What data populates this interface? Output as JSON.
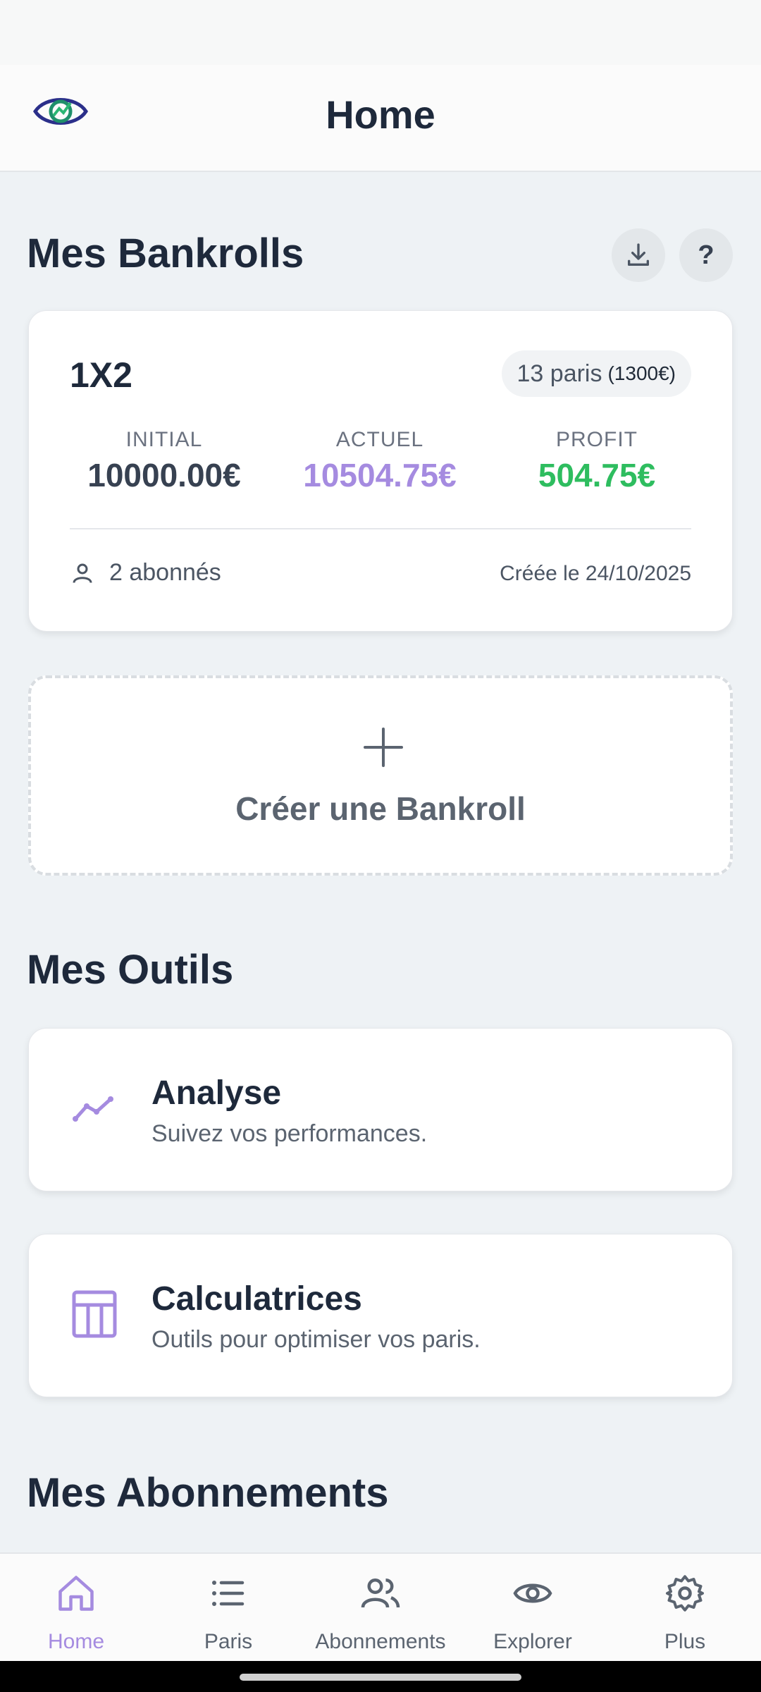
{
  "header": {
    "title": "Home"
  },
  "bankrolls": {
    "section_title": "Mes Bankrolls",
    "items": [
      {
        "name": "1X2",
        "bets_badge": "13 paris",
        "bets_badge_amount": "(1300€)",
        "initial_label": "INITIAL",
        "initial_value": "10000.00€",
        "current_label": "ACTUEL",
        "current_value": "10504.75€",
        "profit_label": "PROFIT",
        "profit_value": "504.75€",
        "followers": "2 abonnés",
        "created": "Créée le 24/10/2025"
      }
    ],
    "create_label": "Créer une Bankroll"
  },
  "tools": {
    "section_title": "Mes Outils",
    "items": [
      {
        "title": "Analyse",
        "subtitle": "Suivez vos performances.",
        "icon": "trend-chart-icon"
      },
      {
        "title": "Calculatrices",
        "subtitle": "Outils pour optimiser vos paris.",
        "icon": "calculator-table-icon"
      }
    ]
  },
  "subscriptions": {
    "section_title": "Mes Abonnements"
  },
  "nav": {
    "items": [
      {
        "label": "Home",
        "icon": "home-icon",
        "active": true
      },
      {
        "label": "Paris",
        "icon": "list-icon"
      },
      {
        "label": "Abonnements",
        "icon": "users-icon"
      },
      {
        "label": "Explorer",
        "icon": "eye-icon"
      },
      {
        "label": "Plus",
        "icon": "gear-icon"
      }
    ]
  },
  "colors": {
    "accent": "#a58be0",
    "profit": "#2ebd5f",
    "current": "#a58be0",
    "dark": "#1e293b"
  }
}
